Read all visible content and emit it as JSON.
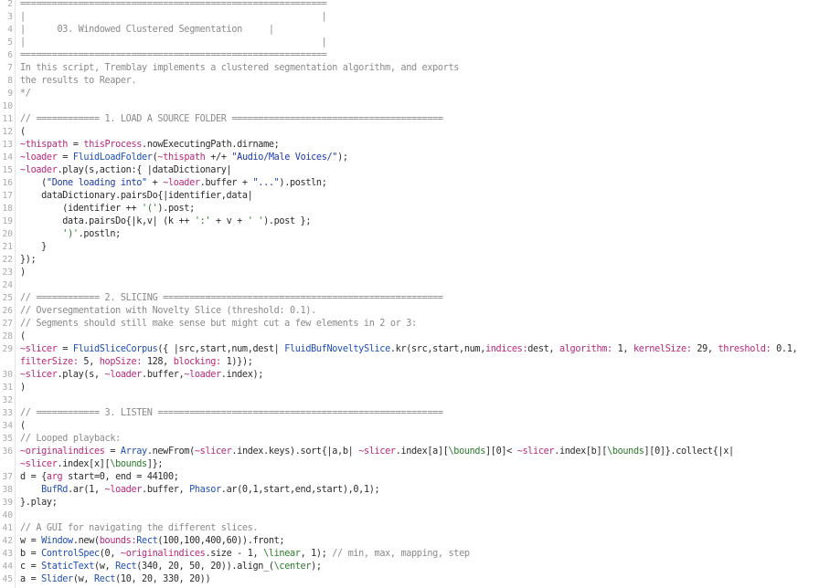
{
  "editor": {
    "title": "03. Windowed Clustered Segmentation",
    "lines": [
      {
        "n": "2",
        "segs": [
          {
            "t": "==========================================================",
            "c": "comment"
          }
        ]
      },
      {
        "n": "3",
        "segs": [
          {
            "t": "|                                                        |",
            "c": "comment"
          }
        ]
      },
      {
        "n": "4",
        "segs": [
          {
            "t": "|      03. Windowed Clustered Segmentation     |",
            "c": "comment"
          }
        ]
      },
      {
        "n": "5",
        "segs": [
          {
            "t": "|                                                        |",
            "c": "comment"
          }
        ]
      },
      {
        "n": "6",
        "segs": [
          {
            "t": "==========================================================",
            "c": "comment"
          }
        ]
      },
      {
        "n": "7",
        "segs": [
          {
            "t": "In this script, Tremblay implements a clustered segmentation algorithm, and exports",
            "c": "comment"
          }
        ]
      },
      {
        "n": "8",
        "segs": [
          {
            "t": "the results to Reaper.",
            "c": "comment"
          }
        ]
      },
      {
        "n": "9",
        "segs": [
          {
            "t": "*/",
            "c": "comment"
          }
        ]
      },
      {
        "n": "10",
        "segs": []
      },
      {
        "n": "11",
        "segs": [
          {
            "t": "// ============ 1. LOAD A SOURCE FOLDER ========================================",
            "c": "comment"
          }
        ]
      },
      {
        "n": "12",
        "segs": [
          {
            "t": "(",
            "c": "plain"
          }
        ]
      },
      {
        "n": "13",
        "segs": [
          {
            "t": "~thispath",
            "c": "env"
          },
          {
            "t": " = ",
            "c": "plain"
          },
          {
            "t": "thisProcess",
            "c": "env"
          },
          {
            "t": ".nowExecutingPath.dirname;",
            "c": "plain"
          }
        ]
      },
      {
        "n": "14",
        "segs": [
          {
            "t": "~loader",
            "c": "env"
          },
          {
            "t": " = ",
            "c": "plain"
          },
          {
            "t": "FluidLoadFolder",
            "c": "class"
          },
          {
            "t": "(",
            "c": "plain"
          },
          {
            "t": "~thispath",
            "c": "env"
          },
          {
            "t": " +/+ ",
            "c": "plain"
          },
          {
            "t": "\"Audio/Male Voices/\"",
            "c": "string"
          },
          {
            "t": ");",
            "c": "plain"
          }
        ]
      },
      {
        "n": "15",
        "segs": [
          {
            "t": "~loader",
            "c": "env"
          },
          {
            "t": ".play(s,action:{ |dataDictionary|",
            "c": "plain"
          }
        ]
      },
      {
        "n": "16",
        "segs": [
          {
            "t": "    (",
            "c": "plain"
          },
          {
            "t": "\"Done loading into\"",
            "c": "string"
          },
          {
            "t": " + ",
            "c": "plain"
          },
          {
            "t": "~loader",
            "c": "env"
          },
          {
            "t": ".buffer + ",
            "c": "plain"
          },
          {
            "t": "\"...\"",
            "c": "string"
          },
          {
            "t": ").postln;",
            "c": "plain"
          }
        ]
      },
      {
        "n": "17",
        "segs": [
          {
            "t": "    dataDictionary.pairsDo{|identifier,data|",
            "c": "plain"
          }
        ]
      },
      {
        "n": "18",
        "segs": [
          {
            "t": "        (identifier ++ ",
            "c": "plain"
          },
          {
            "t": "'('",
            "c": "symbol"
          },
          {
            "t": ").post;",
            "c": "plain"
          }
        ]
      },
      {
        "n": "19",
        "segs": [
          {
            "t": "        data.pairsDo{|k,v| (k ++ ",
            "c": "plain"
          },
          {
            "t": "':'",
            "c": "symbol"
          },
          {
            "t": " + v + ",
            "c": "plain"
          },
          {
            "t": "' '",
            "c": "symbol"
          },
          {
            "t": ").post };",
            "c": "plain"
          }
        ]
      },
      {
        "n": "20",
        "segs": [
          {
            "t": "        ",
            "c": "plain"
          },
          {
            "t": "')'",
            "c": "symbol"
          },
          {
            "t": ".postln;",
            "c": "plain"
          }
        ]
      },
      {
        "n": "21",
        "segs": [
          {
            "t": "    }",
            "c": "plain"
          }
        ]
      },
      {
        "n": "22",
        "segs": [
          {
            "t": "});",
            "c": "plain"
          }
        ]
      },
      {
        "n": "23",
        "segs": [
          {
            "t": ")",
            "c": "plain"
          }
        ]
      },
      {
        "n": "24",
        "segs": []
      },
      {
        "n": "25",
        "segs": [
          {
            "t": "// ============ 2. SLICING =====================================================",
            "c": "comment"
          }
        ]
      },
      {
        "n": "26",
        "segs": [
          {
            "t": "// Oversegmentation with Novelty Slice (threshold: 0.1).",
            "c": "comment"
          }
        ]
      },
      {
        "n": "27",
        "segs": [
          {
            "t": "// Segments should still make sense but might cut a few elements in 2 or 3:",
            "c": "comment"
          }
        ]
      },
      {
        "n": "28",
        "segs": [
          {
            "t": "(",
            "c": "plain"
          }
        ]
      },
      {
        "n": "29",
        "segs": [
          {
            "t": "~slicer",
            "c": "env"
          },
          {
            "t": " = ",
            "c": "plain"
          },
          {
            "t": "FluidSliceCorpus",
            "c": "class"
          },
          {
            "t": "({ |src,start,num,dest| ",
            "c": "plain"
          },
          {
            "t": "FluidBufNoveltySlice",
            "c": "class"
          },
          {
            "t": ".kr(src,start,num,",
            "c": "plain"
          },
          {
            "t": "indices:",
            "c": "env"
          },
          {
            "t": "dest, ",
            "c": "plain"
          },
          {
            "t": "algorithm:",
            "c": "env"
          },
          {
            "t": " 1, ",
            "c": "plain"
          },
          {
            "t": "kernelSize:",
            "c": "env"
          },
          {
            "t": " 29, ",
            "c": "plain"
          },
          {
            "t": "threshold:",
            "c": "env"
          },
          {
            "t": " 0.1,",
            "c": "plain"
          }
        ]
      },
      {
        "n": "",
        "segs": [
          {
            "t": "filterSize:",
            "c": "env"
          },
          {
            "t": " 5, ",
            "c": "plain"
          },
          {
            "t": "hopSize:",
            "c": "env"
          },
          {
            "t": " 128, ",
            "c": "plain"
          },
          {
            "t": "blocking:",
            "c": "env"
          },
          {
            "t": " 1)});",
            "c": "plain"
          }
        ]
      },
      {
        "n": "30",
        "segs": [
          {
            "t": "~slicer",
            "c": "env"
          },
          {
            "t": ".play(s, ",
            "c": "plain"
          },
          {
            "t": "~loader",
            "c": "env"
          },
          {
            "t": ".buffer,",
            "c": "plain"
          },
          {
            "t": "~loader",
            "c": "env"
          },
          {
            "t": ".index);",
            "c": "plain"
          }
        ]
      },
      {
        "n": "31",
        "segs": [
          {
            "t": ")",
            "c": "plain"
          }
        ]
      },
      {
        "n": "32",
        "segs": []
      },
      {
        "n": "33",
        "segs": [
          {
            "t": "// ============ 3. LISTEN ======================================================",
            "c": "comment"
          }
        ]
      },
      {
        "n": "34",
        "segs": [
          {
            "t": "(",
            "c": "plain"
          }
        ]
      },
      {
        "n": "35",
        "segs": [
          {
            "t": "// Looped playback:",
            "c": "comment"
          }
        ]
      },
      {
        "n": "36",
        "segs": [
          {
            "t": "~originalindices",
            "c": "env"
          },
          {
            "t": " = ",
            "c": "plain"
          },
          {
            "t": "Array",
            "c": "class"
          },
          {
            "t": ".newFrom(",
            "c": "plain"
          },
          {
            "t": "~slicer",
            "c": "env"
          },
          {
            "t": ".index.keys).sort{|a,b| ",
            "c": "plain"
          },
          {
            "t": "~slicer",
            "c": "env"
          },
          {
            "t": ".index[a][",
            "c": "plain"
          },
          {
            "t": "\\bounds",
            "c": "symbol"
          },
          {
            "t": "][0]< ",
            "c": "plain"
          },
          {
            "t": "~slicer",
            "c": "env"
          },
          {
            "t": ".index[b][",
            "c": "plain"
          },
          {
            "t": "\\bounds",
            "c": "symbol"
          },
          {
            "t": "][0]}.collect{|x|",
            "c": "plain"
          }
        ]
      },
      {
        "n": "",
        "segs": [
          {
            "t": "~slicer",
            "c": "env"
          },
          {
            "t": ".index[x][",
            "c": "plain"
          },
          {
            "t": "\\bounds",
            "c": "symbol"
          },
          {
            "t": "]};",
            "c": "plain"
          }
        ]
      },
      {
        "n": "37",
        "segs": [
          {
            "t": "d = {",
            "c": "plain"
          },
          {
            "t": "arg",
            "c": "env"
          },
          {
            "t": " start=0, end = 44100;",
            "c": "plain"
          }
        ]
      },
      {
        "n": "38",
        "segs": [
          {
            "t": "    ",
            "c": "plain"
          },
          {
            "t": "BufRd",
            "c": "class"
          },
          {
            "t": ".ar(1, ",
            "c": "plain"
          },
          {
            "t": "~loader",
            "c": "env"
          },
          {
            "t": ".buffer, ",
            "c": "plain"
          },
          {
            "t": "Phasor",
            "c": "class"
          },
          {
            "t": ".ar(0,1,start,end,start),0,1);",
            "c": "plain"
          }
        ]
      },
      {
        "n": "39",
        "segs": [
          {
            "t": "}.play;",
            "c": "plain"
          }
        ]
      },
      {
        "n": "40",
        "segs": []
      },
      {
        "n": "41",
        "segs": [
          {
            "t": "// A GUI for navigating the different slices.",
            "c": "comment"
          }
        ]
      },
      {
        "n": "42",
        "segs": [
          {
            "t": "w = ",
            "c": "plain"
          },
          {
            "t": "Window",
            "c": "class"
          },
          {
            "t": ".new(",
            "c": "plain"
          },
          {
            "t": "bounds:",
            "c": "env"
          },
          {
            "t": "Rect",
            "c": "class"
          },
          {
            "t": "(100,100,400,60)).front;",
            "c": "plain"
          }
        ]
      },
      {
        "n": "43",
        "segs": [
          {
            "t": "b = ",
            "c": "plain"
          },
          {
            "t": "ControlSpec",
            "c": "class"
          },
          {
            "t": "(0, ",
            "c": "plain"
          },
          {
            "t": "~originalindices",
            "c": "env"
          },
          {
            "t": ".size - 1, ",
            "c": "plain"
          },
          {
            "t": "\\linear",
            "c": "symbol"
          },
          {
            "t": ", 1); ",
            "c": "plain"
          },
          {
            "t": "// min, max, mapping, step",
            "c": "comment"
          }
        ]
      },
      {
        "n": "44",
        "segs": [
          {
            "t": "c = ",
            "c": "plain"
          },
          {
            "t": "StaticText",
            "c": "class"
          },
          {
            "t": "(w, ",
            "c": "plain"
          },
          {
            "t": "Rect",
            "c": "class"
          },
          {
            "t": "(340, 20, 50, 20)).align_(",
            "c": "plain"
          },
          {
            "t": "\\center",
            "c": "symbol"
          },
          {
            "t": ");",
            "c": "plain"
          }
        ]
      },
      {
        "n": "45",
        "segs": [
          {
            "t": "a = ",
            "c": "plain"
          },
          {
            "t": "Slider",
            "c": "class"
          },
          {
            "t": "(w, ",
            "c": "plain"
          },
          {
            "t": "Rect",
            "c": "class"
          },
          {
            "t": "(10, 20, 330, 20))",
            "c": "plain"
          }
        ]
      }
    ]
  }
}
